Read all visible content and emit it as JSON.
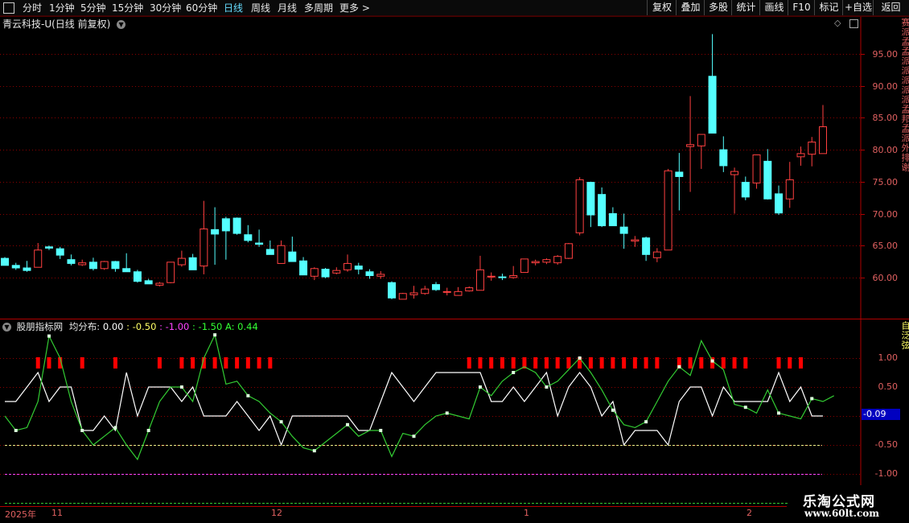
{
  "toolbar": {
    "left_icon": "window-icon",
    "periods": [
      "分时",
      "1分钟",
      "5分钟",
      "15分钟",
      "30分钟",
      "60分钟",
      "日线",
      "周线",
      "月线",
      "多周期",
      "更多 >"
    ],
    "active_period": "日线",
    "right_buttons": [
      "复权",
      "叠加",
      "多股",
      "统计",
      "画线",
      "F10",
      "标记",
      "+自选",
      "返回"
    ]
  },
  "stock": {
    "title": "青云科技-U(日线 前复权)",
    "dropdown_icon": "chevron-down-circle-icon",
    "side_text": "赛派孟孟派派派派派孟邦孟派外排谢"
  },
  "price_axis": {
    "labels": [
      "95.00",
      "90.00",
      "85.00",
      "80.00",
      "75.00",
      "70.00",
      "65.00",
      "60.00"
    ],
    "values": [
      95,
      90,
      85,
      80,
      75,
      70,
      65,
      60
    ]
  },
  "indicator": {
    "name": "股朋指标网",
    "title_label": "均分布:",
    "v1": "0.00",
    "v2": ": -0.50",
    "v3": ": -1.00",
    "v4": ": -1.50",
    "v5": "A: 0.44",
    "current_value": "-0.09",
    "axis_labels": [
      "1.00",
      "0.50",
      "0",
      "-0.50",
      "-1.00"
    ],
    "axis_values": [
      1.0,
      0.5,
      0,
      -0.5,
      -1.0
    ],
    "side_text": "自泛弦"
  },
  "dates": {
    "year_label": "2025年",
    "months": [
      "11",
      "12",
      "1",
      "2"
    ]
  },
  "watermark": {
    "line1": "乐淘公式网",
    "line2": "www.60lt.com"
  },
  "colors": {
    "up": "#ff4040",
    "down": "#54ffff",
    "grid": "#8b0000",
    "white_line": "#ffffff",
    "green_line": "#33cc33",
    "red_marker": "#ff0000"
  },
  "chart_data": {
    "type": "candlestick",
    "ohlc": [
      [
        63,
        63.2,
        61.9,
        61.9
      ],
      [
        61.9,
        62.3,
        61.2,
        61.5
      ],
      [
        61.5,
        62.6,
        60.9,
        61.1
      ],
      [
        61.6,
        65.4,
        61.6,
        64.3
      ],
      [
        64.8,
        65,
        64.3,
        64.6
      ],
      [
        64.5,
        64.8,
        62.9,
        63.5
      ],
      [
        62.8,
        63.6,
        61.9,
        62.2
      ],
      [
        62,
        62.8,
        61.8,
        62.3
      ],
      [
        62.4,
        63.1,
        61.1,
        61.4
      ],
      [
        61.4,
        62.6,
        61.2,
        62.5
      ],
      [
        62.5,
        62.6,
        60.9,
        61.4
      ],
      [
        61.4,
        63.8,
        61.2,
        60.9
      ],
      [
        60.9,
        61.2,
        59.2,
        59.4
      ],
      [
        59.5,
        59.8,
        59,
        59
      ],
      [
        58.8,
        59.3,
        58.6,
        59.1
      ],
      [
        59.2,
        62.4,
        59.1,
        62.4
      ],
      [
        62,
        64.2,
        61.7,
        63
      ],
      [
        63.1,
        63.7,
        61.3,
        61.2
      ],
      [
        61.8,
        72,
        60.5,
        67.6
      ],
      [
        67.5,
        71,
        62,
        66.8
      ],
      [
        69.2,
        69.5,
        62.8,
        67.3
      ],
      [
        69.3,
        69.4,
        66.7,
        66.9
      ],
      [
        66.7,
        68.2,
        65.5,
        65.8
      ],
      [
        65.4,
        67.5,
        64.8,
        65.2
      ],
      [
        64.4,
        65.8,
        63.8,
        63.6
      ],
      [
        62.2,
        65.8,
        63.6,
        65
      ],
      [
        64,
        66.4,
        63.8,
        62.5
      ],
      [
        62.6,
        63.2,
        60.4,
        60.4
      ],
      [
        60.2,
        61.6,
        59.6,
        61.4
      ],
      [
        61.3,
        61.5,
        59.9,
        60.1
      ],
      [
        60.7,
        61.6,
        60.5,
        61.1
      ],
      [
        61.2,
        63.6,
        60.9,
        62.2
      ],
      [
        61.8,
        62.3,
        60.5,
        61.3
      ],
      [
        60.9,
        61.3,
        59.8,
        60.3
      ],
      [
        60.2,
        61,
        59.8,
        60.5
      ],
      [
        59.2,
        59.4,
        56.6,
        56.8
      ],
      [
        56.6,
        57.6,
        56.6,
        57.5
      ],
      [
        57.3,
        58.7,
        56.7,
        57.6
      ],
      [
        57.5,
        58.7,
        57.3,
        58.2
      ],
      [
        58.9,
        59.3,
        57.9,
        58.1
      ],
      [
        57.8,
        58.4,
        57.2,
        57.8
      ],
      [
        57.2,
        58.5,
        57.2,
        57.8
      ],
      [
        57.9,
        58.6,
        57.8,
        58.4
      ],
      [
        58,
        63.4,
        58,
        61.2
      ],
      [
        60.2,
        60.8,
        59.5,
        60.2
      ],
      [
        60.1,
        60.6,
        59.6,
        60
      ],
      [
        60,
        61.8,
        59.8,
        60.3
      ],
      [
        60.8,
        62.9,
        60.8,
        62.9
      ],
      [
        62.3,
        62.8,
        61.9,
        62.5
      ],
      [
        62.4,
        63,
        62.1,
        62.8
      ],
      [
        62.3,
        63.5,
        62,
        63.3
      ],
      [
        63,
        65.4,
        62.9,
        65.3
      ],
      [
        67,
        75.7,
        66.6,
        75.3
      ],
      [
        74.9,
        75,
        67.9,
        69.8
      ],
      [
        73,
        74.1,
        67.9,
        68.1
      ],
      [
        70,
        71,
        68.1,
        68.1
      ],
      [
        67.9,
        70,
        64.5,
        66.9
      ],
      [
        65.7,
        66.5,
        64.8,
        65.9
      ],
      [
        66.2,
        66.4,
        62.6,
        63.6
      ],
      [
        63.1,
        64.6,
        62.4,
        64
      ],
      [
        64.3,
        77,
        64.3,
        76.7
      ],
      [
        76.5,
        79.5,
        70.5,
        75.8
      ],
      [
        80.5,
        88.4,
        73.4,
        80.8
      ],
      [
        80.6,
        82.4,
        77,
        82.4
      ],
      [
        91.5,
        98.1,
        82.6,
        82.6
      ],
      [
        80,
        82.1,
        76.5,
        77.5
      ],
      [
        76.1,
        77.2,
        70,
        76.6
      ],
      [
        74.9,
        75.8,
        72.1,
        72.6
      ],
      [
        74.8,
        78.8,
        73.9,
        79.2
      ],
      [
        78.2,
        80.1,
        72.2,
        72.3
      ],
      [
        73.1,
        74.4,
        69.8,
        70.1
      ],
      [
        72.3,
        78.1,
        70.9,
        75.3
      ],
      [
        78.9,
        80.5,
        77.5,
        79.4
      ],
      [
        79.3,
        82,
        77.4,
        81.2
      ],
      [
        79.4,
        87,
        79.4,
        83.6
      ]
    ],
    "indicator_white": [
      0.25,
      0.25,
      0.5,
      0.75,
      0.25,
      0.5,
      0.5,
      -0.25,
      -0.25,
      0,
      -0.25,
      0.75,
      0,
      0.5,
      0.5,
      0.5,
      0.25,
      0.5,
      0,
      0,
      0,
      0.25,
      0,
      -0.25,
      0,
      -0.5,
      0,
      0,
      0,
      0,
      0,
      0,
      -0.25,
      -0.25,
      0.25,
      0.75,
      0.5,
      0.25,
      0.5,
      0.75,
      0.75,
      0.75,
      0.75,
      0.75,
      0.25,
      0.25,
      0.5,
      0.25,
      0.5,
      0.75,
      0,
      0.5,
      0.75,
      0.5,
      0,
      0.25,
      -0.5,
      -0.25,
      -0.25,
      -0.25,
      -0.5,
      0.25,
      0.5,
      0.5,
      0,
      0.5,
      0.25,
      0.25,
      0.25,
      0.25,
      0.75,
      0.25,
      0.5,
      0,
      0
    ],
    "indicator_green": [
      0,
      -0.25,
      -0.2,
      0.25,
      1.38,
      1,
      0.25,
      -0.25,
      -0.5,
      -0.35,
      -0.2,
      -0.5,
      -0.75,
      -0.25,
      0.25,
      0.5,
      0.5,
      0.25,
      1.0,
      1.4,
      0.55,
      0.6,
      0.35,
      0.25,
      0.05,
      -0.1,
      -0.35,
      -0.55,
      -0.6,
      -0.45,
      -0.3,
      -0.15,
      -0.35,
      -0.25,
      -0.25,
      -0.7,
      -0.3,
      -0.35,
      -0.15,
      0,
      0.05,
      0,
      -0.05,
      0.5,
      0.35,
      0.6,
      0.75,
      0.85,
      0.75,
      0.5,
      0.6,
      0.8,
      1.0,
      0.75,
      0.45,
      0.1,
      -0.15,
      -0.2,
      -0.1,
      0.25,
      0.6,
      0.85,
      0.7,
      1.3,
      0.95,
      0.8,
      0.2,
      0.15,
      0.05,
      0.45,
      0.05,
      0.0,
      -0.05,
      0.3,
      0.25,
      0.35
    ],
    "markers": [
      3,
      4,
      5,
      7,
      10,
      14,
      16,
      17,
      18,
      19,
      20,
      21,
      22,
      23,
      24,
      42,
      43,
      44,
      45,
      46,
      47,
      48,
      49,
      50,
      51,
      52,
      53,
      54,
      55,
      56,
      57,
      58,
      59,
      61,
      62,
      63,
      64,
      65,
      66,
      67,
      70,
      71,
      72
    ]
  }
}
